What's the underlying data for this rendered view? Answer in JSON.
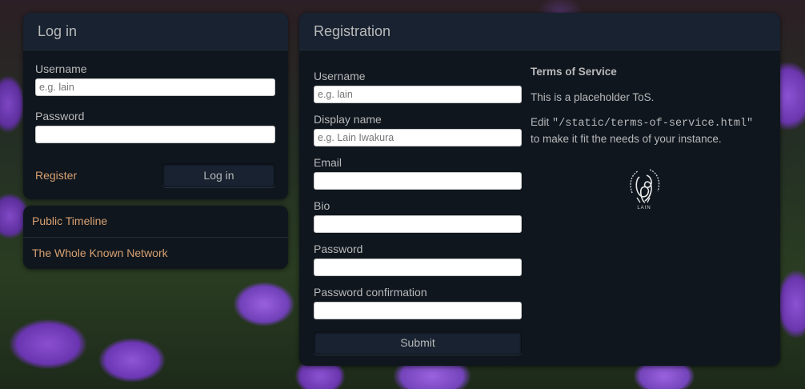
{
  "login": {
    "title": "Log in",
    "username_label": "Username",
    "username_placeholder": "e.g. lain",
    "password_label": "Password",
    "register_link": "Register",
    "login_button": "Log in"
  },
  "nav": {
    "items": [
      {
        "label": "Public Timeline"
      },
      {
        "label": "The Whole Known Network"
      }
    ]
  },
  "registration": {
    "title": "Registration",
    "fields": {
      "username_label": "Username",
      "username_placeholder": "e.g. lain",
      "display_name_label": "Display name",
      "display_name_placeholder": "e.g. Lain Iwakura",
      "email_label": "Email",
      "bio_label": "Bio",
      "password_label": "Password",
      "password_confirmation_label": "Password confirmation"
    },
    "submit_button": "Submit"
  },
  "tos": {
    "heading": "Terms of Service",
    "line1": "This is a placeholder ToS.",
    "edit_prefix": "Edit ",
    "edit_path": "\"/static/terms-of-service.html\"",
    "edit_suffix": "to make it fit the needs of your instance.",
    "seal_icon": "lain-seal-icon",
    "seal_text": "LAIN"
  },
  "colors": {
    "panel_bg": "#0f161e",
    "panel_heading_bg": "#182230",
    "link": "#d8a070",
    "text": "#b9b9ba"
  }
}
